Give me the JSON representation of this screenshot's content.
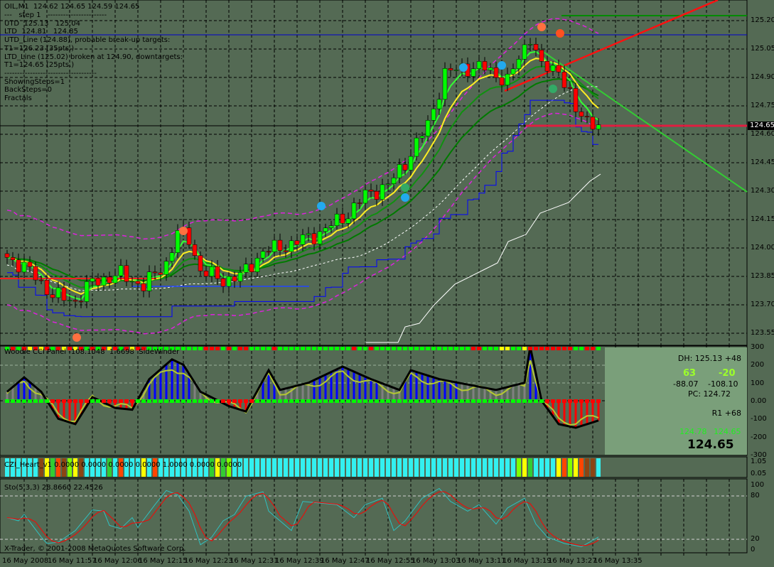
{
  "window": {
    "symbol_header": "OIL,M1  124.62 124.65 124.59 124.65"
  },
  "overlay_text": [
    "---   step 1   -----------------------",
    "UTD  125.13   125.04",
    "LTD  124.81   124.85",
    "UTD_Line (124.88), probable break-up targets:",
    "T1=126.23 (35pts.)",
    "LTD_Line (125.02) broken at 124.90, downtargets:",
    "T1=124.65 (25pts.)",
    "------------------------------------",
    "ShowingSteps=1",
    "BackSteps=0",
    "Fractals"
  ],
  "price_axis": [
    "125.20",
    "125.05",
    "124.90",
    "124.75",
    "124.60",
    "124.45",
    "124.30",
    "124.15",
    "124.00",
    "123.85",
    "123.70",
    "123.55"
  ],
  "current_price": "124.65",
  "time_axis": [
    "16 May 2008",
    "16 May 11:57",
    "16 May 12:06",
    "16 May 12:15",
    "16 May 12:23",
    "16 May 12:31",
    "16 May 12:39",
    "16 May 12:47",
    "16 May 12:55",
    "16 May 13:03",
    "16 May 13:11",
    "16 May 13:19",
    "16 May 13:27",
    "16 May 13:35"
  ],
  "cci_panel": {
    "label": "Woodie CCI Panel -108.1048  1.6698  SideWinder",
    "axis": [
      "300",
      "200",
      "100",
      "0.00",
      "-100",
      "-200",
      "-300"
    ],
    "info": {
      "dh": "DH: 125.13 +48",
      "v1": "63",
      "v2": "-20",
      "c1": "-88.07",
      "c2": "-108.10",
      "pc": "PC: 124.72",
      "r1": "R1 +68",
      "g1": "124.78",
      "g2": "124.65",
      "price": "124.65"
    },
    "top_strip": "GRGRYRYRGRYRYRGRGRYRGRYRRGGGGGGGGGGRRRGRGRRGGGGRGGGGGGGGGGGGGRGGRGGGGGGGGGGGGGGGGGRRGGGYYGGYRRRRRRRRGGRRG",
    "waypoints": [
      [
        0,
        50
      ],
      [
        3,
        130
      ],
      [
        6,
        50
      ],
      [
        9,
        -100
      ],
      [
        12,
        -130
      ],
      [
        15,
        20
      ],
      [
        19,
        -40
      ],
      [
        22,
        -50
      ],
      [
        25,
        120
      ],
      [
        29,
        230
      ],
      [
        31,
        200
      ],
      [
        34,
        50
      ],
      [
        39,
        -30
      ],
      [
        42,
        -60
      ],
      [
        46,
        170
      ],
      [
        48,
        60
      ],
      [
        53,
        100
      ],
      [
        59,
        190
      ],
      [
        64,
        120
      ],
      [
        69,
        60
      ],
      [
        71,
        170
      ],
      [
        76,
        120
      ],
      [
        86,
        60
      ],
      [
        91,
        100
      ],
      [
        92,
        300
      ],
      [
        94,
        0
      ],
      [
        97,
        -130
      ],
      [
        100,
        -150
      ],
      [
        104,
        -110
      ]
    ]
  },
  "czi_panel": {
    "label": "CZI_Heart_v1 0.0000 0.0000 0.0000 0.0000 1.0000 0.0000 0.0000",
    "axis": [
      "1.05",
      "0.05"
    ],
    "colors": "CCCCCCBYGOBLYBCCCCGCOCCCYCOCCCCCCCCCGYGLCCCCCCCCCCCCCCCCCCCCCCCCCCCCCCCCCCCCCCCCCCCCCCCCCCLYGCCCCYOLYOBB",
    "palette": {
      "C": "#33f0f0",
      "B": "#8b4513",
      "Y": "#ffff00",
      "G": "#32cd32",
      "O": "#ff4500",
      "L": "#7fff00"
    }
  },
  "stoch_panel": {
    "label": "Sto(5,3,3) 28.8660 22.4526",
    "axis": [
      "100",
      "80",
      "20",
      "0"
    ],
    "copyright": "X-Trader, © 2001-2008 MetaQuotes Software Corp.",
    "main_waypoints": [
      [
        0,
        50
      ],
      [
        2,
        45
      ],
      [
        3,
        55
      ],
      [
        6,
        20
      ],
      [
        7,
        10
      ],
      [
        9,
        12
      ],
      [
        12,
        30
      ],
      [
        15,
        62
      ],
      [
        17,
        60
      ],
      [
        18,
        38
      ],
      [
        20,
        33
      ],
      [
        22,
        50
      ],
      [
        23,
        35
      ],
      [
        26,
        70
      ],
      [
        28,
        92
      ],
      [
        30,
        85
      ],
      [
        32,
        60
      ],
      [
        34,
        8
      ],
      [
        36,
        20
      ],
      [
        38,
        45
      ],
      [
        40,
        55
      ],
      [
        42,
        83
      ],
      [
        45,
        90
      ],
      [
        46,
        60
      ],
      [
        50,
        30
      ],
      [
        52,
        75
      ],
      [
        58,
        70
      ],
      [
        61,
        50
      ],
      [
        63,
        70
      ],
      [
        66,
        80
      ],
      [
        68,
        30
      ],
      [
        70,
        45
      ],
      [
        73,
        80
      ],
      [
        76,
        95
      ],
      [
        78,
        75
      ],
      [
        81,
        60
      ],
      [
        83,
        70
      ],
      [
        86,
        40
      ],
      [
        88,
        65
      ],
      [
        91,
        80
      ],
      [
        93,
        40
      ],
      [
        95,
        20
      ],
      [
        98,
        10
      ],
      [
        101,
        5
      ],
      [
        104,
        20
      ]
    ]
  },
  "chart_data": {
    "type": "candlestick",
    "title": "OIL,M1",
    "bar_count": 105,
    "ylim": [
      123.5,
      125.25
    ],
    "close_waypoints": [
      [
        0,
        123.95
      ],
      [
        3,
        123.9
      ],
      [
        5,
        123.85
      ],
      [
        8,
        123.75
      ],
      [
        12,
        123.72
      ],
      [
        15,
        123.82
      ],
      [
        20,
        123.86
      ],
      [
        24,
        123.8
      ],
      [
        28,
        123.92
      ],
      [
        30,
        124.08
      ],
      [
        32,
        124.05
      ],
      [
        34,
        123.88
      ],
      [
        38,
        123.83
      ],
      [
        41,
        123.85
      ],
      [
        45,
        123.98
      ],
      [
        50,
        124.02
      ],
      [
        55,
        124.08
      ],
      [
        60,
        124.18
      ],
      [
        63,
        124.28
      ],
      [
        67,
        124.33
      ],
      [
        70,
        124.45
      ],
      [
        74,
        124.65
      ],
      [
        77,
        124.92
      ],
      [
        80,
        124.95
      ],
      [
        84,
        124.95
      ],
      [
        88,
        124.88
      ],
      [
        92,
        125.12
      ],
      [
        94,
        124.95
      ],
      [
        97,
        124.95
      ],
      [
        100,
        124.72
      ],
      [
        104,
        124.65
      ]
    ]
  },
  "colors": {
    "bull": "#00ff00",
    "bear": "#ff0000",
    "grid": "#000000",
    "background": "#546a54",
    "info_bg": "#7a9f7a"
  }
}
